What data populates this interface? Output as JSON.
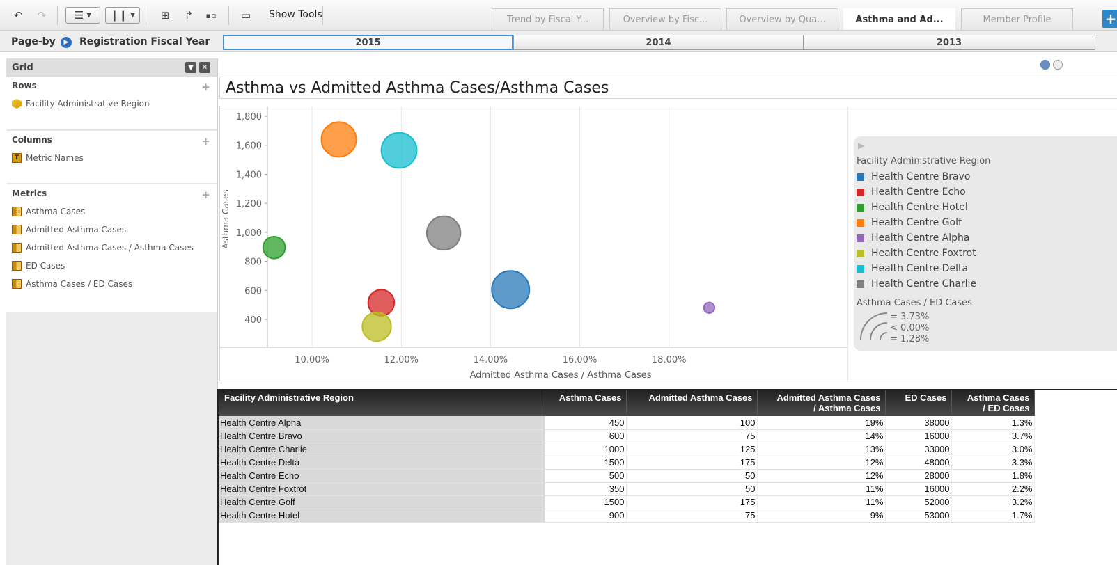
{
  "toolbar": {
    "show_tools_label": "Show Tools",
    "tabs": [
      {
        "label": "Trend by Fiscal Y...",
        "active": false
      },
      {
        "label": "Overview by Fisc...",
        "active": false
      },
      {
        "label": "Overview by Qua...",
        "active": false
      },
      {
        "label": "Asthma and Ad...",
        "active": true
      },
      {
        "label": "Member Profile",
        "active": false
      }
    ],
    "add_tab_label": "+"
  },
  "pageby": {
    "label": "Page-by",
    "field": "Registration Fiscal Year",
    "years": [
      "2015",
      "2014",
      "2013"
    ],
    "selected": "2015"
  },
  "left_panel": {
    "title": "Grid",
    "rows_title": "Rows",
    "rows": [
      "Facility Administrative Region"
    ],
    "columns_title": "Columns",
    "columns": [
      "Metric Names"
    ],
    "metrics_title": "Metrics",
    "metrics": [
      "Asthma Cases",
      "Admitted Asthma Cases",
      "Admitted Asthma Cases / Asthma Cases",
      "ED Cases",
      "Asthma Cases / ED Cases"
    ]
  },
  "chart_data": {
    "type": "scatter",
    "title": "Asthma vs Admitted Asthma Cases/Asthma Cases",
    "xlabel": "Admitted Asthma Cases / Asthma Cases",
    "ylabel": "Asthma Cases",
    "xlim": [
      9.0,
      22.0
    ],
    "ylim": [
      200,
      1850
    ],
    "x_ticks": [
      "10.00%",
      "12.00%",
      "14.00%",
      "16.00%",
      "18.00%"
    ],
    "x_tick_values": [
      10,
      12,
      14,
      16,
      18
    ],
    "y_ticks": [
      "1,800",
      "1,600",
      "1,400",
      "1,200",
      "1,000",
      "800",
      "600",
      "400"
    ],
    "y_tick_values": [
      1800,
      1600,
      1400,
      1200,
      1000,
      800,
      600,
      400
    ],
    "legend_title": "Facility Administrative Region",
    "size_metric": "Asthma Cases / ED Cases",
    "size_legend": [
      "= 3.73%",
      "< 0.00%",
      "= 1.28%"
    ],
    "series": [
      {
        "name": "Health Centre Bravo",
        "color": "#2878b8",
        "x": 14.45,
        "y": 605,
        "size": 3.73
      },
      {
        "name": "Health Centre Echo",
        "color": "#d62728",
        "x": 11.55,
        "y": 515,
        "size": 1.8
      },
      {
        "name": "Health Centre Hotel",
        "color": "#2ca02c",
        "x": 9.15,
        "y": 895,
        "size": 1.28
      },
      {
        "name": "Health Centre Golf",
        "color": "#ff7f0e",
        "x": 10.6,
        "y": 1640,
        "size": 3.2
      },
      {
        "name": "Health Centre Alpha",
        "color": "#9467bd",
        "x": 18.9,
        "y": 480,
        "size": 0.3
      },
      {
        "name": "Health Centre Foxtrot",
        "color": "#bcbd22",
        "x": 11.45,
        "y": 350,
        "size": 2.2
      },
      {
        "name": "Health Centre Delta",
        "color": "#17becf",
        "x": 11.95,
        "y": 1565,
        "size": 3.3
      },
      {
        "name": "Health Centre Charlie",
        "color": "#7f7f7f",
        "x": 12.95,
        "y": 995,
        "size": 3.0
      }
    ]
  },
  "table": {
    "headers": [
      [
        "Facility Administrative Region"
      ],
      [
        "Asthma Cases"
      ],
      [
        "Admitted Asthma Cases"
      ],
      [
        "Admitted Asthma Cases",
        "/ Asthma Cases"
      ],
      [
        "ED Cases"
      ],
      [
        "Asthma Cases",
        "/ ED Cases"
      ]
    ],
    "rows": [
      [
        "Health Centre Alpha",
        "450",
        "100",
        "19%",
        "38000",
        "1.3%"
      ],
      [
        "Health Centre Bravo",
        "600",
        "75",
        "14%",
        "16000",
        "3.7%"
      ],
      [
        "Health Centre Charlie",
        "1000",
        "125",
        "13%",
        "33000",
        "3.0%"
      ],
      [
        "Health Centre Delta",
        "1500",
        "175",
        "12%",
        "48000",
        "3.3%"
      ],
      [
        "Health Centre Echo",
        "500",
        "50",
        "12%",
        "28000",
        "1.8%"
      ],
      [
        "Health Centre Foxtrot",
        "350",
        "50",
        "11%",
        "16000",
        "2.2%"
      ],
      [
        "Health Centre Golf",
        "1500",
        "175",
        "11%",
        "52000",
        "3.2%"
      ],
      [
        "Health Centre Hotel",
        "900",
        "75",
        "9%",
        "53000",
        "1.7%"
      ]
    ]
  }
}
